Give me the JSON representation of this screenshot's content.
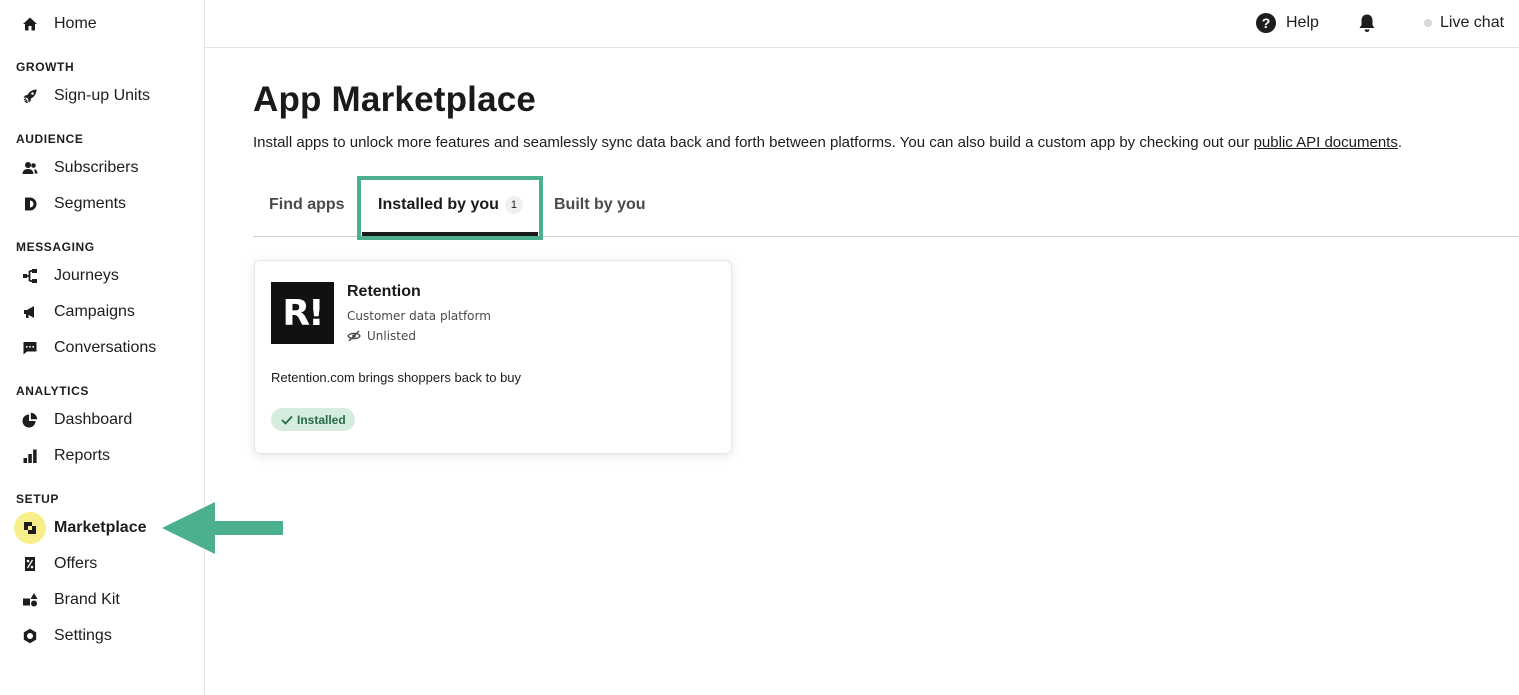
{
  "sidebar": {
    "home": "Home",
    "sections": {
      "growth": "GROWTH",
      "audience": "AUDIENCE",
      "messaging": "MESSAGING",
      "analytics": "ANALYTICS",
      "setup": "SETUP"
    },
    "items": {
      "signup_units": "Sign-up Units",
      "subscribers": "Subscribers",
      "segments": "Segments",
      "journeys": "Journeys",
      "campaigns": "Campaigns",
      "conversations": "Conversations",
      "dashboard": "Dashboard",
      "reports": "Reports",
      "marketplace": "Marketplace",
      "offers": "Offers",
      "brand_kit": "Brand Kit",
      "settings": "Settings"
    },
    "active_item": "Marketplace"
  },
  "topbar": {
    "help": "Help",
    "help_glyph": "?",
    "live_chat": "Live chat"
  },
  "main": {
    "title": "App Marketplace",
    "description": "Install apps to unlock more features and seamlessly sync data back and forth between platforms. You can also build a custom app by checking out our ",
    "description_link": "public API documents",
    "description_end": ".",
    "tabs": {
      "find": "Find apps",
      "installed": "Installed by you",
      "installed_count": "1",
      "built": "Built by you"
    },
    "active_tab": "Installed by you"
  },
  "card": {
    "logo_text": "R!",
    "name": "Retention",
    "category": "Customer data platform",
    "visibility": "Unlisted",
    "description": "Retention.com brings shoppers back to buy",
    "status": "Installed"
  },
  "colors": {
    "highlight": "#4caf8d",
    "active_icon_bg": "#f8ef8b",
    "badge_bg": "#d6ecdf",
    "badge_text": "#256b45"
  }
}
